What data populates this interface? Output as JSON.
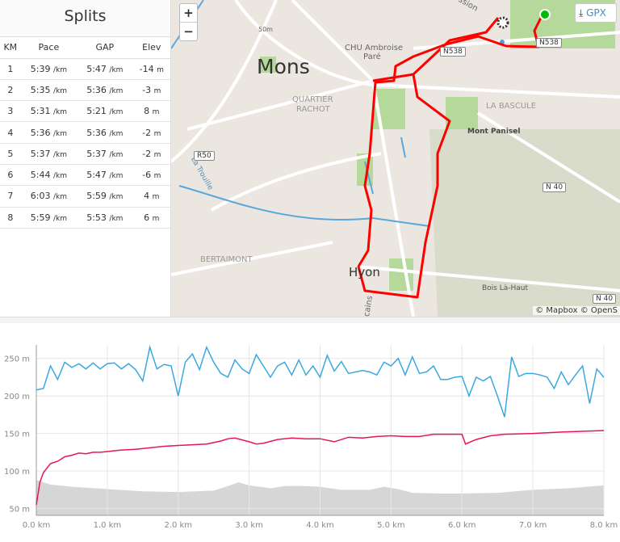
{
  "splits": {
    "title": "Splits",
    "columns": [
      "KM",
      "Pace",
      "GAP",
      "Elev"
    ],
    "pace_unit": "/km",
    "elev_unit": "m",
    "rows": [
      {
        "km": "1",
        "pace": "5:39",
        "gap": "5:47",
        "elev": "-14"
      },
      {
        "km": "2",
        "pace": "5:35",
        "gap": "5:36",
        "elev": "-3"
      },
      {
        "km": "3",
        "pace": "5:31",
        "gap": "5:21",
        "elev": "8"
      },
      {
        "km": "4",
        "pace": "5:36",
        "gap": "5:36",
        "elev": "-2"
      },
      {
        "km": "5",
        "pace": "5:37",
        "gap": "5:37",
        "elev": "-2"
      },
      {
        "km": "6",
        "pace": "5:44",
        "gap": "5:47",
        "elev": "-6"
      },
      {
        "km": "7",
        "pace": "6:03",
        "gap": "5:59",
        "elev": "4"
      },
      {
        "km": "8",
        "pace": "5:59",
        "gap": "5:53",
        "elev": "6"
      }
    ]
  },
  "map": {
    "zoom_in": "+",
    "zoom_out": "−",
    "gpx_label": "GPX",
    "gpx_icon": "download-icon",
    "attribution": "© Mapbox © OpenS",
    "route_color": "#ff0000",
    "start_color": "#00b000",
    "labels": {
      "city": "Mons",
      "quartier1": "QUARTIER",
      "quartier2": "RACHOT",
      "chu1": "CHU Ambroise",
      "chu2": "Paré",
      "bascule": "LA BASCULE",
      "panisel": "Mont Panisel",
      "bertaimont": "BERTAIMONT",
      "hyon": "Hyon",
      "bois": "Bois Là-Haut",
      "trouille": "La Trouille",
      "contour": "50m",
      "ssion": "ssion",
      "icains": "icains"
    },
    "shields": {
      "r50": "R50",
      "n538a": "N538",
      "n538b": "N538",
      "n40a": "N 40",
      "n40b": "N 40"
    }
  },
  "chart_data": {
    "type": "line",
    "x_ticks": [
      "0.0 km",
      "1.0 km",
      "2.0 km",
      "3.0 km",
      "4.0 km",
      "5.0 km",
      "6.0 km",
      "7.0 km",
      "8.0 km"
    ],
    "y_ticks": [
      "50 m",
      "100 m",
      "150 m",
      "200 m",
      "250 m"
    ],
    "xlim": [
      0,
      8
    ],
    "ylim": [
      41,
      268
    ],
    "grid": true,
    "series": [
      {
        "color": "#3aa8e0",
        "type": "line",
        "points": [
          [
            0,
            208
          ],
          [
            0.1,
            210
          ],
          [
            0.2,
            240
          ],
          [
            0.3,
            222
          ],
          [
            0.4,
            245
          ],
          [
            0.5,
            238
          ],
          [
            0.6,
            243
          ],
          [
            0.7,
            236
          ],
          [
            0.8,
            244
          ],
          [
            0.9,
            236
          ],
          [
            1.0,
            243
          ],
          [
            1.1,
            244
          ],
          [
            1.2,
            236
          ],
          [
            1.3,
            243
          ],
          [
            1.4,
            235
          ],
          [
            1.5,
            220
          ],
          [
            1.6,
            265
          ],
          [
            1.7,
            236
          ],
          [
            1.8,
            242
          ],
          [
            1.9,
            240
          ],
          [
            2.0,
            200
          ],
          [
            2.1,
            245
          ],
          [
            2.2,
            256
          ],
          [
            2.3,
            235
          ],
          [
            2.4,
            265
          ],
          [
            2.5,
            245
          ],
          [
            2.6,
            230
          ],
          [
            2.7,
            225
          ],
          [
            2.8,
            248
          ],
          [
            2.9,
            236
          ],
          [
            3.0,
            230
          ],
          [
            3.1,
            255
          ],
          [
            3.2,
            240
          ],
          [
            3.3,
            225
          ],
          [
            3.4,
            240
          ],
          [
            3.5,
            245
          ],
          [
            3.6,
            228
          ],
          [
            3.7,
            248
          ],
          [
            3.8,
            228
          ],
          [
            3.9,
            240
          ],
          [
            4.0,
            225
          ],
          [
            4.1,
            254
          ],
          [
            4.2,
            233
          ],
          [
            4.3,
            246
          ],
          [
            4.4,
            230
          ],
          [
            4.5,
            232
          ],
          [
            4.6,
            234
          ],
          [
            4.7,
            232
          ],
          [
            4.8,
            228
          ],
          [
            4.9,
            245
          ],
          [
            5.0,
            240
          ],
          [
            5.1,
            250
          ],
          [
            5.2,
            228
          ],
          [
            5.3,
            252
          ],
          [
            5.4,
            230
          ],
          [
            5.5,
            232
          ],
          [
            5.6,
            240
          ],
          [
            5.7,
            222
          ],
          [
            5.8,
            222
          ],
          [
            5.9,
            225
          ],
          [
            6.0,
            226
          ],
          [
            6.1,
            200
          ],
          [
            6.2,
            225
          ],
          [
            6.3,
            220
          ],
          [
            6.4,
            226
          ],
          [
            6.5,
            200
          ],
          [
            6.6,
            172
          ],
          [
            6.7,
            252
          ],
          [
            6.8,
            226
          ],
          [
            6.9,
            230
          ],
          [
            7.0,
            230
          ],
          [
            7.1,
            228
          ],
          [
            7.2,
            225
          ],
          [
            7.3,
            210
          ],
          [
            7.4,
            232
          ],
          [
            7.5,
            215
          ],
          [
            7.6,
            228
          ],
          [
            7.7,
            240
          ],
          [
            7.8,
            190
          ],
          [
            7.9,
            236
          ],
          [
            8.0,
            225
          ]
        ]
      },
      {
        "color": "#e8174f",
        "type": "line",
        "points": [
          [
            0,
            55
          ],
          [
            0.05,
            85
          ],
          [
            0.1,
            98
          ],
          [
            0.2,
            110
          ],
          [
            0.3,
            113
          ],
          [
            0.4,
            119
          ],
          [
            0.5,
            121
          ],
          [
            0.6,
            124
          ],
          [
            0.7,
            123
          ],
          [
            0.8,
            125
          ],
          [
            0.9,
            125
          ],
          [
            1.0,
            126
          ],
          [
            1.2,
            128
          ],
          [
            1.4,
            129
          ],
          [
            1.6,
            131
          ],
          [
            1.8,
            133
          ],
          [
            2.0,
            134
          ],
          [
            2.2,
            135
          ],
          [
            2.4,
            136
          ],
          [
            2.6,
            140
          ],
          [
            2.7,
            143
          ],
          [
            2.8,
            144
          ],
          [
            3.0,
            139
          ],
          [
            3.1,
            136
          ],
          [
            3.2,
            137
          ],
          [
            3.4,
            142
          ],
          [
            3.6,
            144
          ],
          [
            3.8,
            143
          ],
          [
            4.0,
            143
          ],
          [
            4.2,
            139
          ],
          [
            4.4,
            145
          ],
          [
            4.6,
            144
          ],
          [
            4.8,
            146
          ],
          [
            5.0,
            147
          ],
          [
            5.2,
            146
          ],
          [
            5.4,
            146
          ],
          [
            5.6,
            149
          ],
          [
            5.8,
            149
          ],
          [
            6.0,
            149
          ],
          [
            6.05,
            136
          ],
          [
            6.2,
            142
          ],
          [
            6.4,
            147
          ],
          [
            6.6,
            149
          ],
          [
            7.0,
            150
          ],
          [
            7.4,
            152
          ],
          [
            8.0,
            154
          ]
        ]
      },
      {
        "color": "#d6d6d6",
        "type": "area",
        "points": [
          [
            0,
            88
          ],
          [
            0.2,
            82
          ],
          [
            0.5,
            79
          ],
          [
            1.0,
            76
          ],
          [
            1.5,
            73
          ],
          [
            2.0,
            72
          ],
          [
            2.5,
            74
          ],
          [
            2.7,
            80
          ],
          [
            2.85,
            85
          ],
          [
            3.0,
            81
          ],
          [
            3.3,
            77
          ],
          [
            3.5,
            80
          ],
          [
            3.8,
            80
          ],
          [
            4.0,
            79
          ],
          [
            4.3,
            75
          ],
          [
            4.7,
            75
          ],
          [
            4.9,
            79
          ],
          [
            5.1,
            76
          ],
          [
            5.3,
            71
          ],
          [
            5.7,
            70
          ],
          [
            6.0,
            70
          ],
          [
            6.5,
            71
          ],
          [
            7.0,
            75
          ],
          [
            7.5,
            77
          ],
          [
            8.0,
            81
          ]
        ]
      }
    ]
  }
}
